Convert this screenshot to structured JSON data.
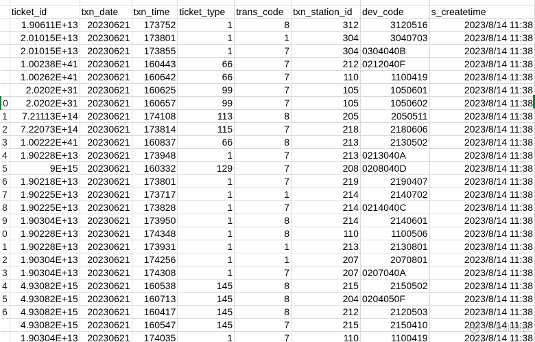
{
  "sheet": {
    "top_row": [
      "",
      "",
      "",
      "",
      "",
      "",
      "",
      "",
      ""
    ],
    "headers": [
      "ticket_id",
      "txn_date",
      "txn_time",
      "ticket_type",
      "trans_code",
      "txn_station_id",
      "dev_code",
      "s_createtime"
    ],
    "row_numbers": [
      "",
      "",
      "",
      "",
      "",
      "",
      "",
      "0",
      "1",
      "2",
      "3",
      "4",
      "5",
      "6",
      "7",
      "8",
      "9",
      "0",
      "1",
      "2",
      "3",
      "4",
      "5",
      "6"
    ],
    "rows": [
      [
        "1.90611E+13",
        "20230621",
        "173752",
        "1",
        "8",
        "312",
        "3120516",
        "2023/8/14 11:38"
      ],
      [
        "2.01015E+13",
        "20230621",
        "173801",
        "1",
        "1",
        "304",
        "3040703",
        "2023/8/14 11:38"
      ],
      [
        "2.01015E+13",
        "20230621",
        "173855",
        "1",
        "7",
        "304",
        "0304040B",
        "2023/8/14 11:38"
      ],
      [
        "1.00238E+41",
        "20230621",
        "160443",
        "66",
        "7",
        "212",
        "0212040F",
        "2023/8/14 11:38"
      ],
      [
        "1.00262E+41",
        "20230621",
        "160642",
        "66",
        "7",
        "110",
        "1100419",
        "2023/8/14 11:38"
      ],
      [
        "2.0202E+31",
        "20230621",
        "160625",
        "99",
        "7",
        "105",
        "1050601",
        "2023/8/14 11:38"
      ],
      [
        "2.0202E+31",
        "20230621",
        "160657",
        "99",
        "7",
        "105",
        "1050602",
        "2023/8/14 11:38"
      ],
      [
        "7.21113E+14",
        "20230621",
        "174108",
        "113",
        "8",
        "205",
        "2050511",
        "2023/8/14 11:38"
      ],
      [
        "7.22073E+14",
        "20230621",
        "173814",
        "115",
        "7",
        "218",
        "2180606",
        "2023/8/14 11:38"
      ],
      [
        "1.00222E+41",
        "20230621",
        "160837",
        "66",
        "8",
        "213",
        "2130502",
        "2023/8/14 11:38"
      ],
      [
        "1.90228E+13",
        "20230621",
        "173948",
        "1",
        "7",
        "213",
        "0213040A",
        "2023/8/14 11:38"
      ],
      [
        "9E+15",
        "20230621",
        "160332",
        "129",
        "7",
        "208",
        "0208040D",
        "2023/8/14 11:38"
      ],
      [
        "1.90218E+13",
        "20230621",
        "173801",
        "1",
        "7",
        "219",
        "2190407",
        "2023/8/14 11:38"
      ],
      [
        "1.90225E+13",
        "20230621",
        "173717",
        "1",
        "1",
        "214",
        "2140702",
        "2023/8/14 11:38"
      ],
      [
        "1.90225E+13",
        "20230621",
        "173828",
        "1",
        "7",
        "214",
        "0214040C",
        "2023/8/14 11:38"
      ],
      [
        "1.90304E+13",
        "20230621",
        "173950",
        "1",
        "8",
        "214",
        "2140601",
        "2023/8/14 11:38"
      ],
      [
        "1.90228E+13",
        "20230621",
        "174348",
        "1",
        "8",
        "110",
        "1100506",
        "2023/8/14 11:38"
      ],
      [
        "1.90228E+13",
        "20230621",
        "173931",
        "1",
        "1",
        "213",
        "2130801",
        "2023/8/14 11:38"
      ],
      [
        "1.90304E+13",
        "20230621",
        "174256",
        "1",
        "1",
        "207",
        "2070801",
        "2023/8/14 11:38"
      ],
      [
        "1.90304E+13",
        "20230621",
        "174308",
        "1",
        "7",
        "207",
        "0207040A",
        "2023/8/14 11:38"
      ],
      [
        "4.93082E+15",
        "20230621",
        "160538",
        "145",
        "8",
        "215",
        "2150502",
        "2023/8/14 11:38"
      ],
      [
        "4.93082E+15",
        "20230621",
        "160713",
        "145",
        "8",
        "204",
        "0204050F",
        "2023/8/14 11:38"
      ],
      [
        "4.93082E+15",
        "20230621",
        "160417",
        "145",
        "8",
        "212",
        "2120503",
        "2023/8/14 11:38"
      ],
      [
        "4.93082E+15",
        "20230621",
        "160547",
        "145",
        "7",
        "215",
        "2150410",
        "2023/8/14 11:38"
      ],
      [
        "1.90304E+13",
        "20230621",
        "174035",
        "1",
        "7",
        "110",
        "1100419",
        "2023/8/14 11:38"
      ]
    ],
    "text_columns": [
      6
    ],
    "selected_row_index": 6
  },
  "watermark": {
    "text": "@深圳地铁"
  }
}
